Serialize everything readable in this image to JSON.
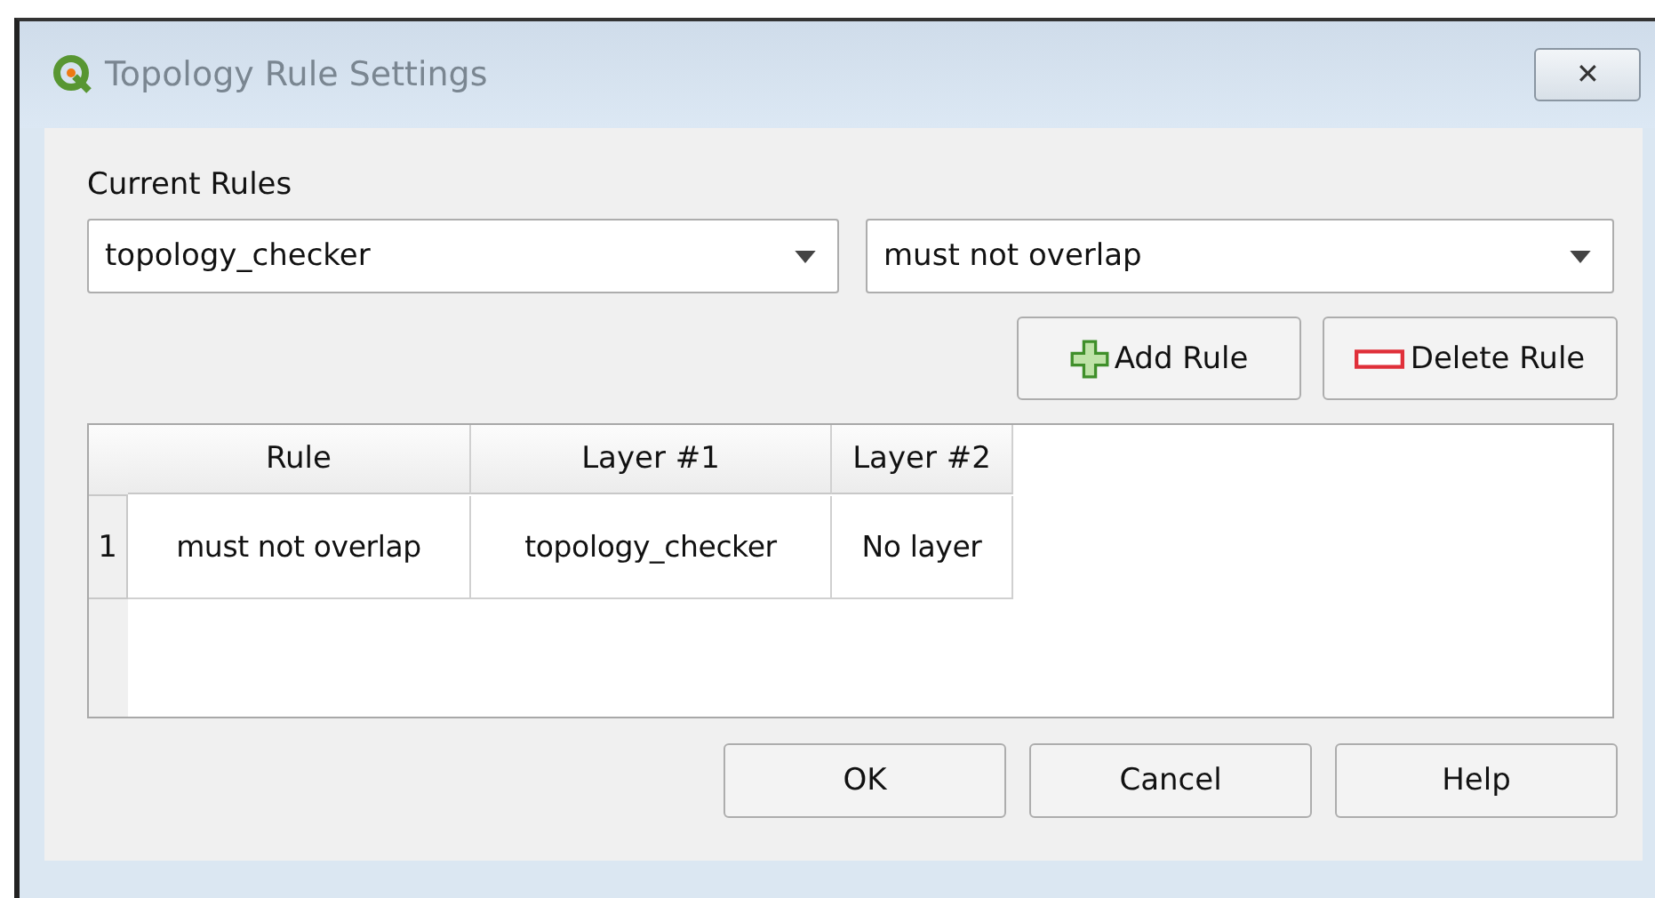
{
  "window": {
    "title": "Topology Rule Settings",
    "close_label": "✕"
  },
  "rules_label": "Current Rules",
  "layer_combo": {
    "value": "topology_checker"
  },
  "rule_combo": {
    "value": "must not overlap"
  },
  "actions": [
    {
      "kind": "add",
      "label": "Add Rule"
    },
    {
      "kind": "delete",
      "label": "Delete Rule"
    }
  ],
  "table": {
    "columns": [
      "Rule",
      "Layer #1",
      "Layer #2"
    ],
    "rows": [
      {
        "index": "1",
        "cells": [
          "must not overlap",
          "topology_checker",
          "No layer"
        ]
      }
    ]
  },
  "buttons": [
    "OK",
    "Cancel",
    "Help"
  ]
}
